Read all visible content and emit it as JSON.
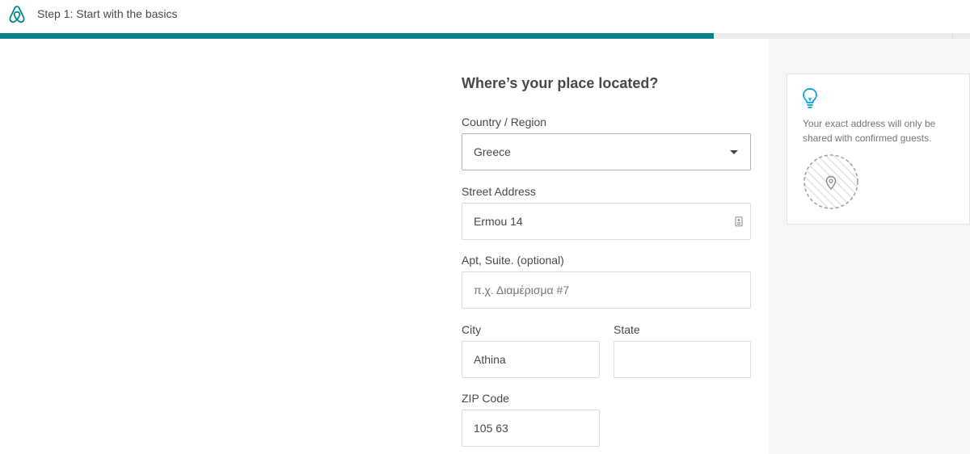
{
  "header": {
    "step_title": "Step 1: Start with the basics",
    "progress_fraction": 0.736,
    "brand_color": "#008489"
  },
  "form": {
    "heading": "Where’s your place located?",
    "country": {
      "label": "Country / Region",
      "value": "Greece"
    },
    "street": {
      "label": "Street Address",
      "value": "Ermou 14"
    },
    "apt": {
      "label": "Apt, Suite. (optional)",
      "value": "",
      "placeholder": "π.χ. Διαμέρισμα #7"
    },
    "city": {
      "label": "City",
      "value": "Athina"
    },
    "state": {
      "label": "State",
      "value": ""
    },
    "zip": {
      "label": "ZIP Code",
      "value": "105 63"
    }
  },
  "tip": {
    "icon": "lightbulb-icon",
    "text": "Your exact address will only be shared with confirmed guests.",
    "map_icon": "map-pin-icon"
  }
}
